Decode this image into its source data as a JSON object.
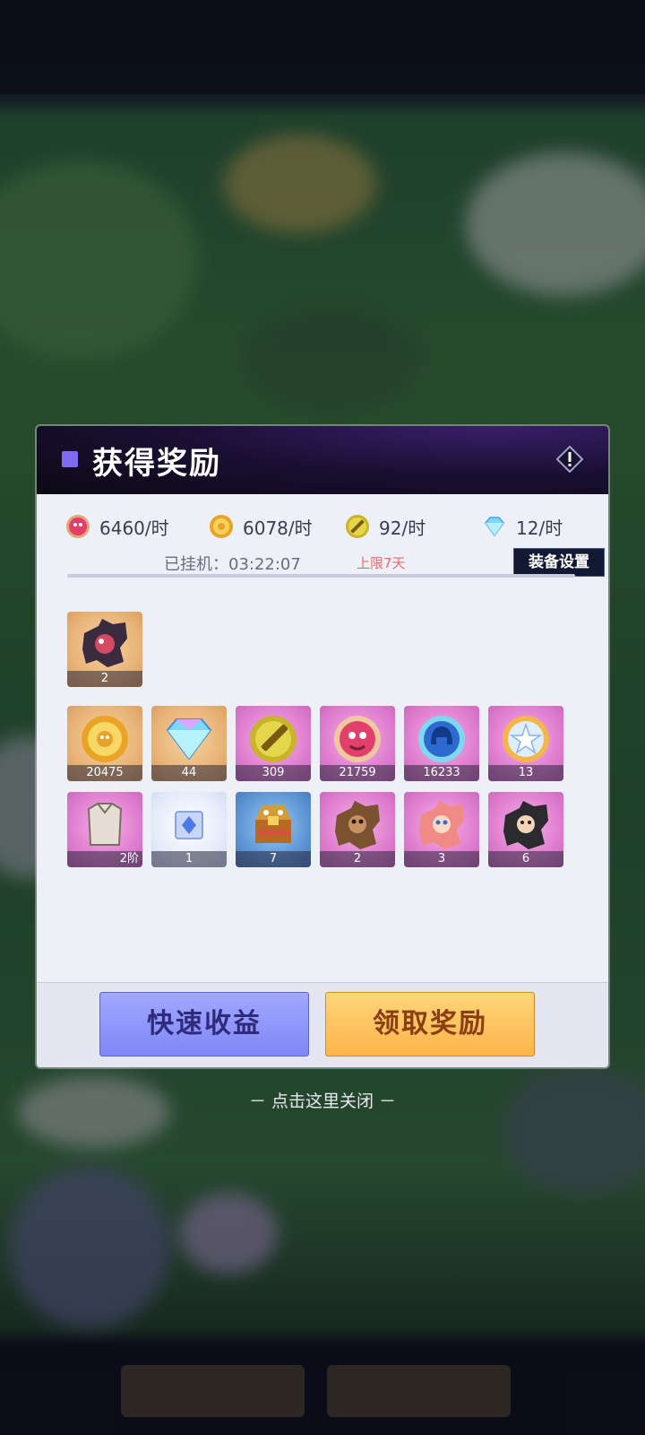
{
  "header": {
    "title": "获得奖励"
  },
  "rates": [
    {
      "icon": "pink-orb-icon",
      "value": "6460/时"
    },
    {
      "icon": "gold-coin-icon",
      "value": "6078/时"
    },
    {
      "icon": "sword-orb-icon",
      "value": "92/时"
    },
    {
      "icon": "diamond-icon",
      "value": "12/时"
    }
  ],
  "timer": {
    "text": "已挂机：03:22:07",
    "limit": "上限7天",
    "equip_button": "装备设置"
  },
  "featured_item": {
    "icon": "hero-shard-icon",
    "count": "2"
  },
  "items": [
    {
      "icon": "gold-coin-icon",
      "count": "20475",
      "bg": "orange"
    },
    {
      "icon": "diamond-icon",
      "count": "44",
      "bg": "orange"
    },
    {
      "icon": "sword-orb-icon",
      "count": "309",
      "bg": "pink"
    },
    {
      "icon": "pink-orb-icon",
      "count": "21759",
      "bg": "pink"
    },
    {
      "icon": "helmet-orb-icon",
      "count": "16233",
      "bg": "pink"
    },
    {
      "icon": "star-orb-icon",
      "count": "13",
      "bg": "pink"
    },
    {
      "icon": "armor-icon",
      "count": "2阶",
      "bg": "pink"
    },
    {
      "icon": "blue-gem-icon",
      "count": "1",
      "bg": "pale"
    },
    {
      "icon": "treasure-chest-icon",
      "count": "7",
      "bg": "blue"
    },
    {
      "icon": "hero-shard-icon",
      "count": "2",
      "bg": "pink"
    },
    {
      "icon": "hero-shard-icon",
      "count": "3",
      "bg": "pink"
    },
    {
      "icon": "hero-shard-icon",
      "count": "6",
      "bg": "pink"
    }
  ],
  "buttons": {
    "quick": "快速收益",
    "claim": "领取奖励"
  },
  "close_hint": "－ 点击这里关闭 －"
}
